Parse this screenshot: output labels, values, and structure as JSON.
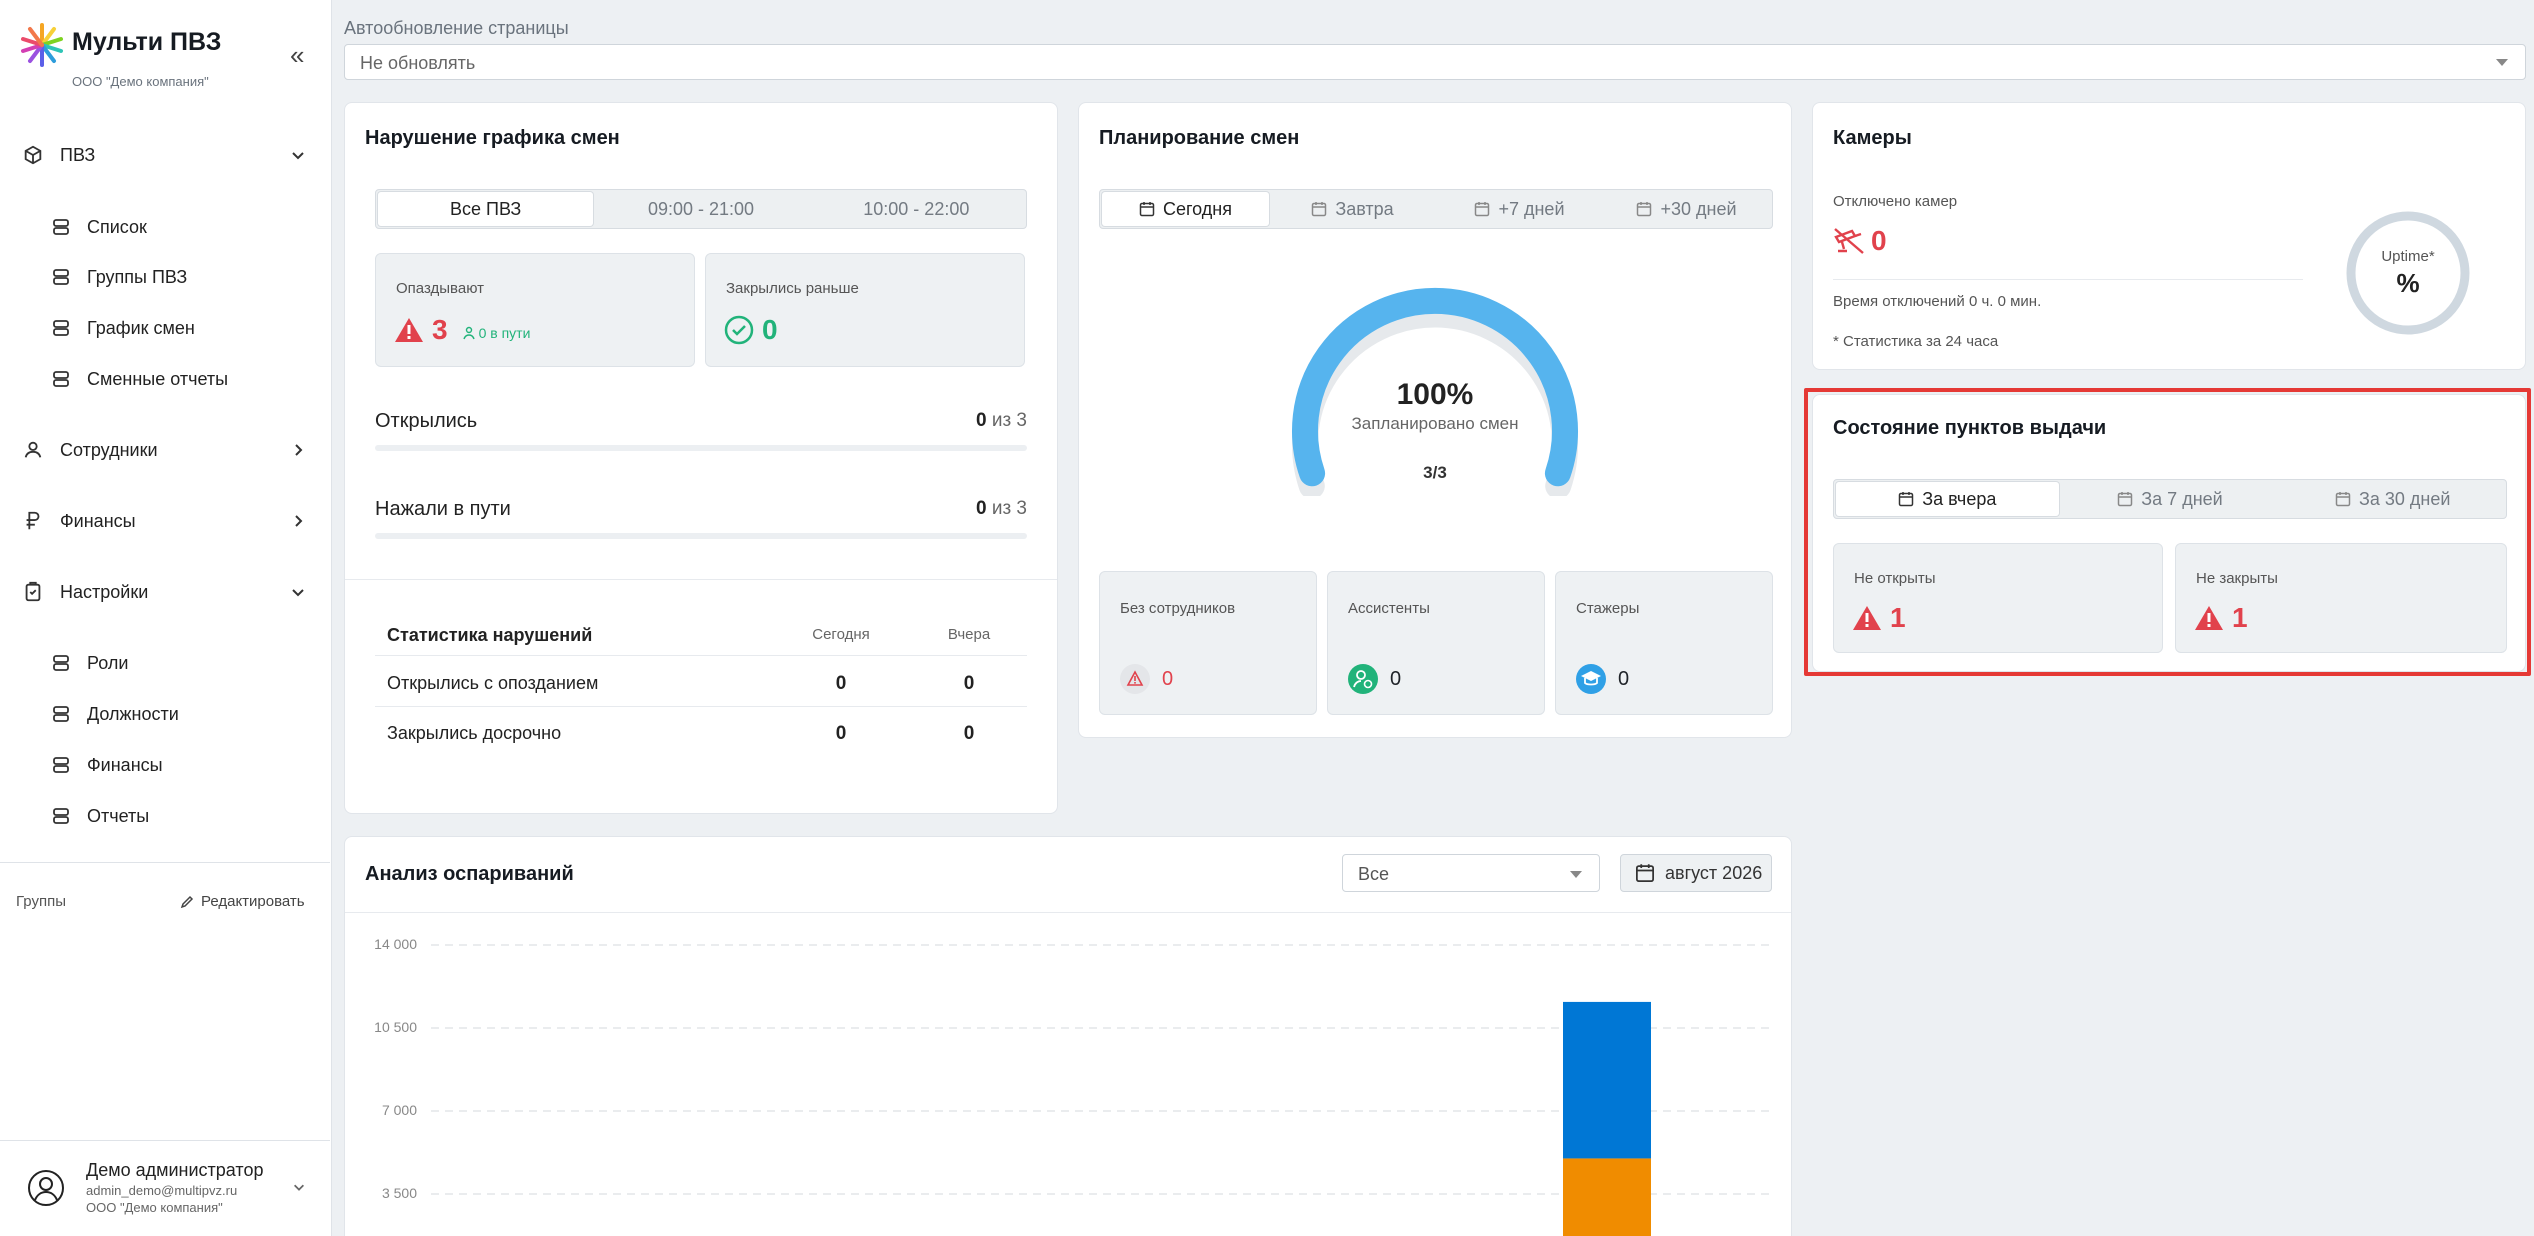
{
  "sidebar": {
    "app_title": "Мульти ПВЗ",
    "company": "ООО \"Демо компания\"",
    "collapse_glyph": "«",
    "nav": {
      "pvz": "ПВЗ",
      "list": "Список",
      "groups": "Группы ПВЗ",
      "schedule": "График смен",
      "reports": "Сменные отчеты",
      "employees": "Сотрудники",
      "finance": "Финансы",
      "settings": "Настройки",
      "roles": "Роли",
      "positions": "Должности",
      "finance_settings": "Финансы",
      "report_settings": "Отчеты"
    },
    "groups_label": "Группы",
    "edit_label": "Редактировать",
    "user": {
      "name": "Демо администратор",
      "email": "admin_demo@multipvz.ru",
      "company": "ООО \"Демо компания\""
    }
  },
  "auto_refresh": {
    "label": "Автообновление страницы",
    "value": "Не обновлять"
  },
  "violations": {
    "title": "Нарушение графика смен",
    "tabs": [
      "Все ПВЗ",
      "09:00 - 21:00",
      "10:00 - 22:00"
    ],
    "late_label": "Опаздывают",
    "late_value": "3",
    "late_route": "0 в пути",
    "closed_early_label": "Закрылись раньше",
    "closed_early_value": "0",
    "opened_label": "Открылись",
    "opened_value": "0",
    "opened_total": "из 3",
    "route_label": "Нажали в пути",
    "route_value": "0",
    "route_total": "из 3",
    "stats": {
      "title": "Статистика нарушений",
      "col_today": "Сегодня",
      "col_yesterday": "Вчера",
      "rows": [
        {
          "label": "Открылись с опозданием",
          "today": "0",
          "yesterday": "0"
        },
        {
          "label": "Закрылись досрочно",
          "today": "0",
          "yesterday": "0"
        }
      ]
    }
  },
  "planning": {
    "title": "Планирование смен",
    "tabs": [
      "Сегодня",
      "Завтра",
      "+7 дней",
      "+30 дней"
    ],
    "gauge_percent": "100%",
    "gauge_label": "Запланировано смен",
    "gauge_count": "3/3",
    "gauge_fraction": 1,
    "tiles": [
      {
        "label": "Без сотрудников",
        "value": "0"
      },
      {
        "label": "Ассистенты",
        "value": "0"
      },
      {
        "label": "Стажеры",
        "value": "0"
      }
    ]
  },
  "cameras": {
    "title": "Камеры",
    "disabled_label": "Отключено камер",
    "disabled_value": "0",
    "downtime": "Время отключений 0 ч. 0 мин.",
    "note": "* Статистика за 24 часа",
    "uptime_label": "Uptime*",
    "uptime_value": "%"
  },
  "points_status": {
    "title": "Состояние пунктов выдачи",
    "tabs": [
      "За вчера",
      "За 7 дней",
      "За 30 дней"
    ],
    "not_opened_label": "Не открыты",
    "not_opened_value": "1",
    "not_closed_label": "Не закрыты",
    "not_closed_value": "1"
  },
  "disputes": {
    "title": "Анализ оспариваний",
    "filter_value": "Все",
    "date_value": "август 2026"
  },
  "colors": {
    "accent_blue": "#56b4ee",
    "warning_red": "#e1424c",
    "success_green": "#21b37a",
    "bar_blue": "#0077d5",
    "bar_orange": "#f08c00",
    "highlight": "#e53935"
  },
  "chart_data": {
    "type": "bar",
    "title": "Анализ оспариваний",
    "ylim": [
      0,
      14000
    ],
    "y_ticks": [
      "14 000",
      "10 500",
      "7 000",
      "3 500"
    ],
    "grid": true,
    "stacked": true,
    "series": [
      {
        "color": "#f08c00",
        "values": [
          5000
        ]
      },
      {
        "color": "#0077d5",
        "values": [
          6600
        ]
      }
    ]
  }
}
